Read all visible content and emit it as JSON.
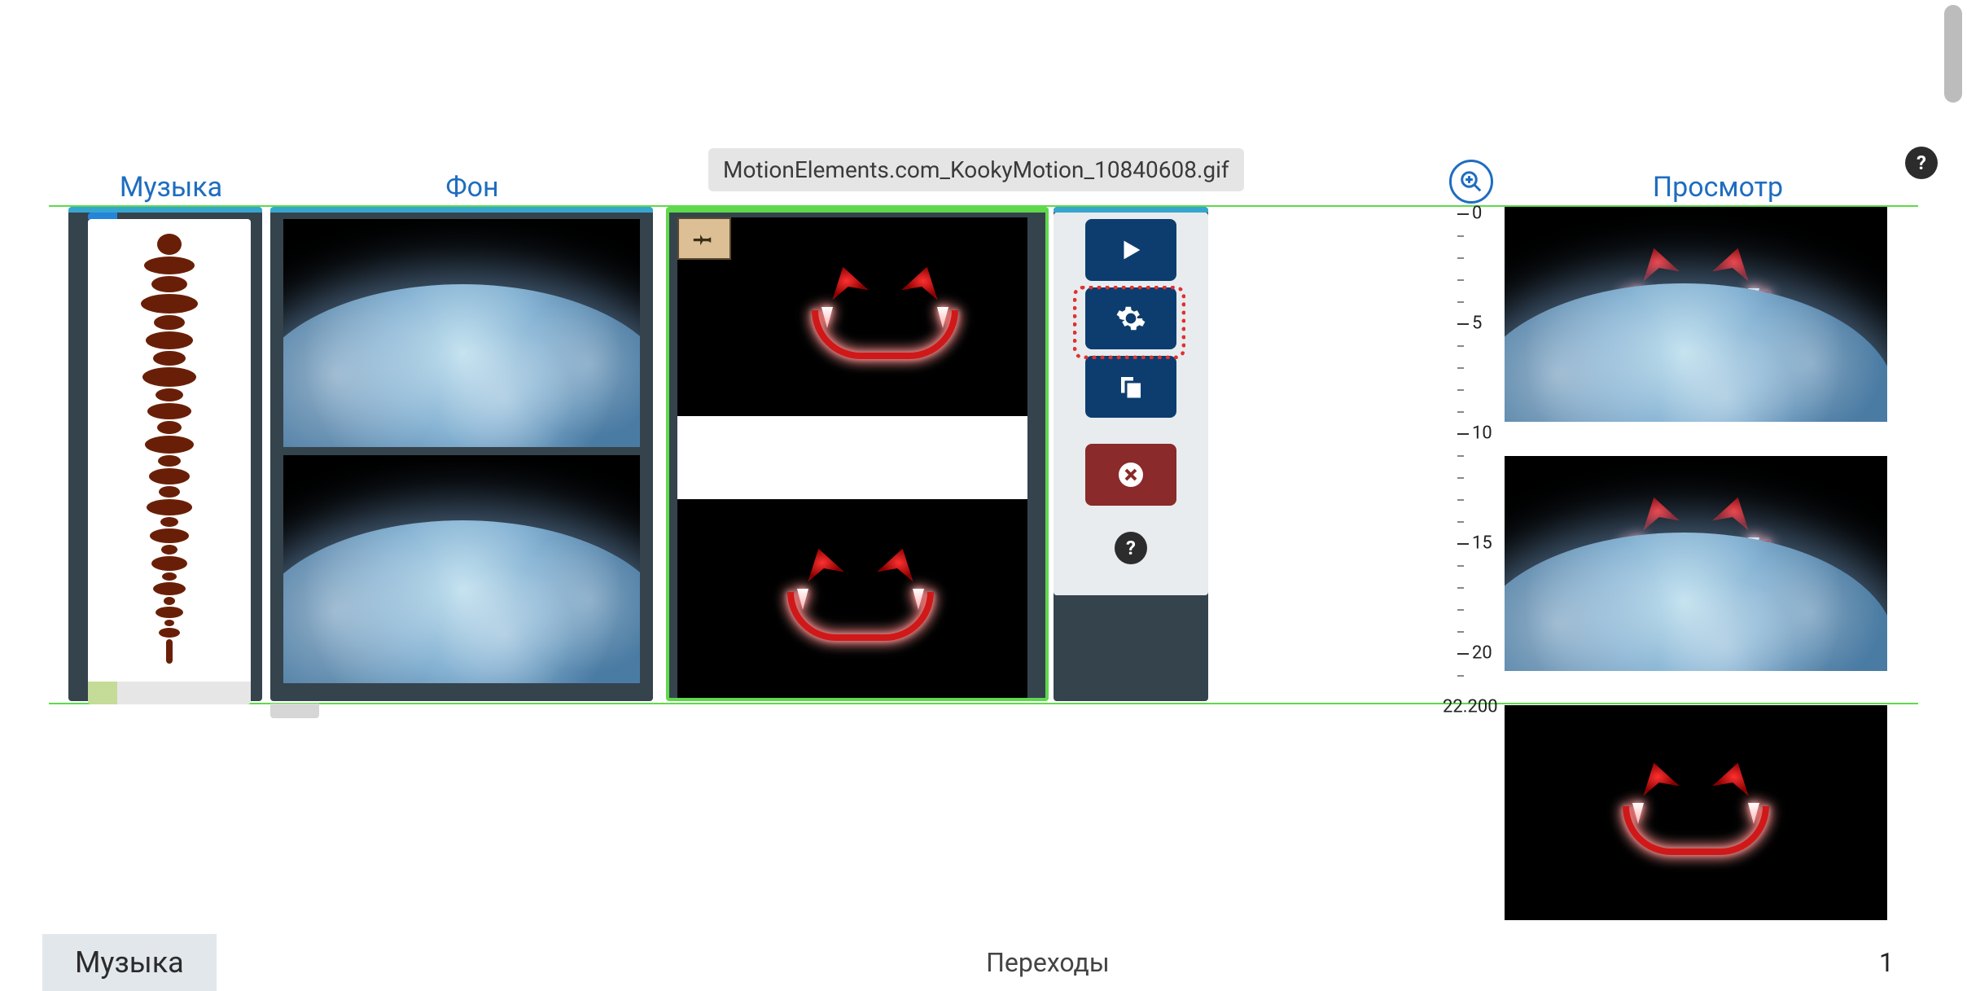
{
  "labels": {
    "music": "Музыка",
    "background": "Фон",
    "preview": "Просмотр"
  },
  "tooltip": "MotionElements.com_KookyMotion_10840608.gif",
  "ruler": {
    "ticks": [
      "0",
      "5",
      "10",
      "15",
      "20"
    ],
    "end": "22.200"
  },
  "toolbar": {
    "play": "play",
    "settings": "settings",
    "duplicate": "duplicate",
    "delete": "delete",
    "help": "?"
  },
  "bottom": {
    "tab": "Музыка",
    "center": "Переходы",
    "page": "1"
  },
  "help_badge": "?"
}
